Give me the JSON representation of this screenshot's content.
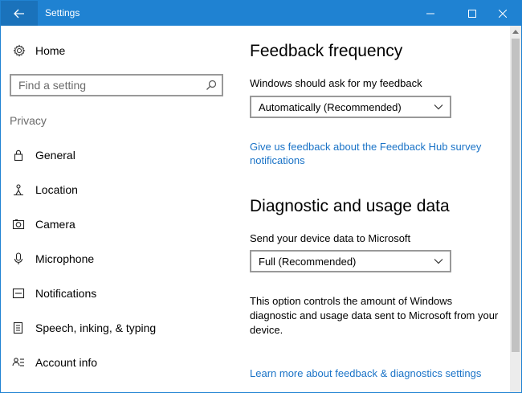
{
  "window": {
    "title": "Settings"
  },
  "sidebar": {
    "home_label": "Home",
    "search_placeholder": "Find a setting",
    "section_label": "Privacy",
    "items": [
      {
        "label": "General",
        "icon": "lock-icon"
      },
      {
        "label": "Location",
        "icon": "location-person-icon"
      },
      {
        "label": "Camera",
        "icon": "camera-icon"
      },
      {
        "label": "Microphone",
        "icon": "microphone-icon"
      },
      {
        "label": "Notifications",
        "icon": "notifications-icon"
      },
      {
        "label": "Speech, inking, & typing",
        "icon": "speech-document-icon"
      },
      {
        "label": "Account info",
        "icon": "account-info-icon"
      }
    ]
  },
  "main": {
    "feedback": {
      "heading": "Feedback frequency",
      "label": "Windows should ask for my feedback",
      "dropdown_value": "Automatically (Recommended)",
      "link": "Give us feedback about the Feedback Hub survey notifications"
    },
    "diagnostic": {
      "heading": "Diagnostic and usage data",
      "label": "Send your device data to Microsoft",
      "dropdown_value": "Full (Recommended)",
      "description": "This option controls the amount of Windows diagnostic and usage data sent to Microsoft from your device.",
      "link": "Learn more about feedback & diagnostics settings"
    }
  },
  "colors": {
    "accent": "#1f82d2",
    "link": "#1a73c7",
    "muted_text": "#6b6b6b"
  }
}
